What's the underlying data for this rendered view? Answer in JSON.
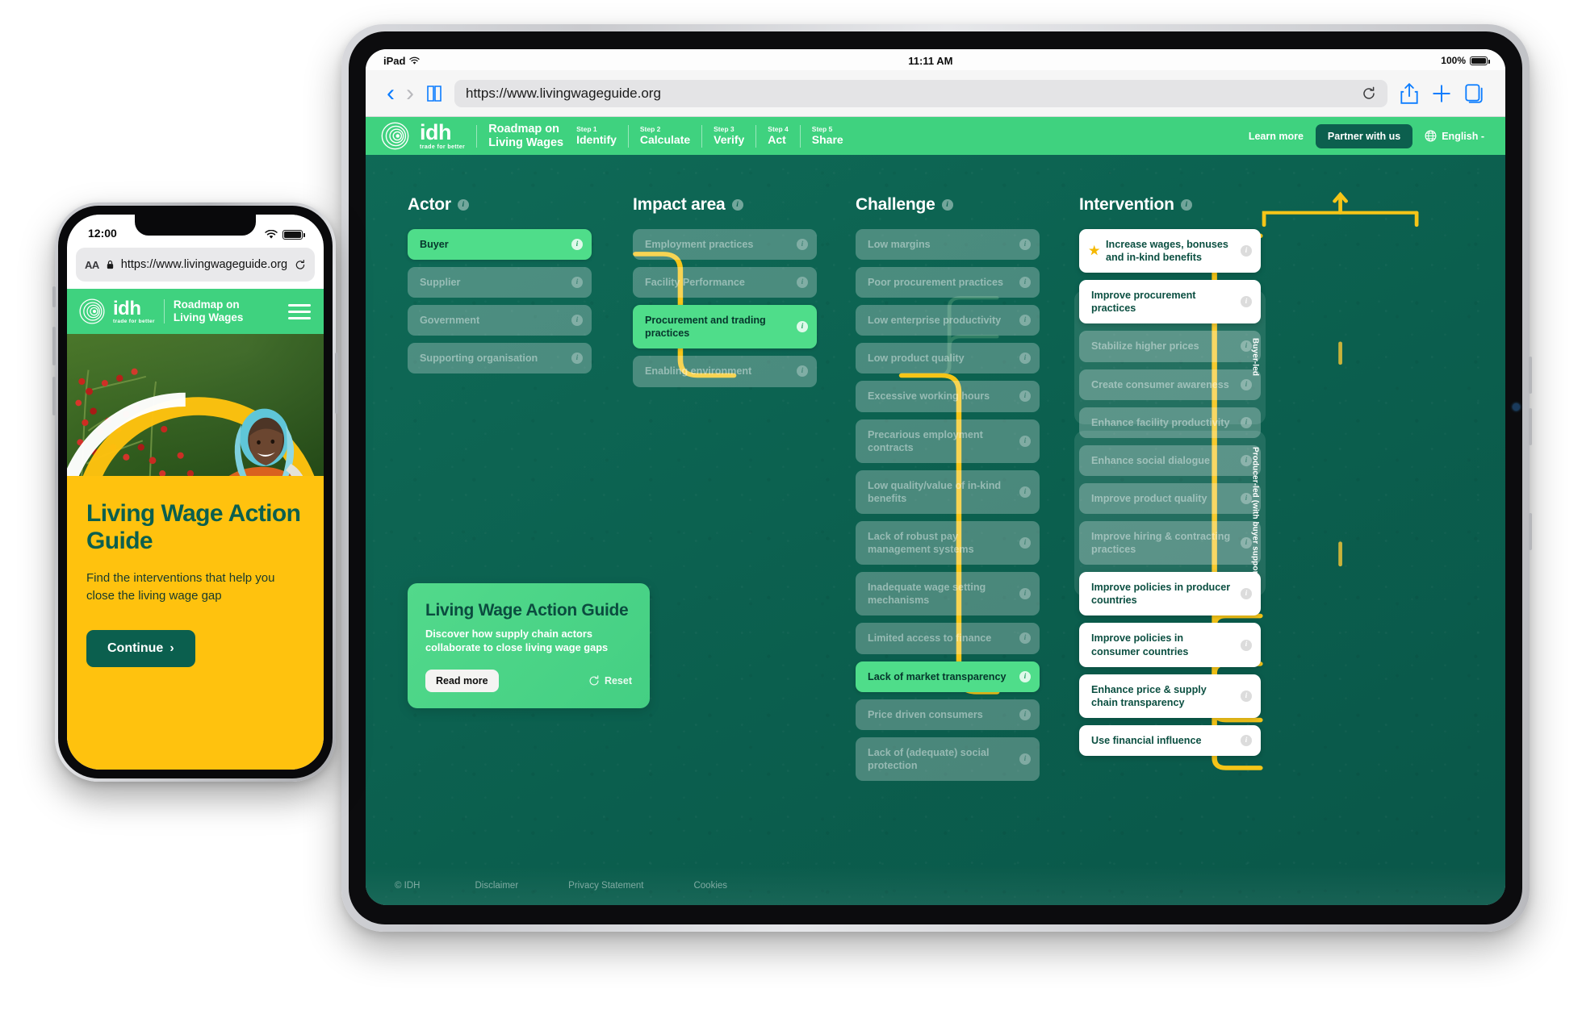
{
  "ipad": {
    "status": {
      "device": "iPad",
      "wifi_icon": "wifi-icon",
      "time": "11:11 AM",
      "battery": "100%"
    },
    "toolbar": {
      "back_icon": "chevron-left-icon",
      "forward_icon": "chevron-right-icon",
      "bookmarks_icon": "book-icon",
      "url": "https://www.livingwageguide.org",
      "reload_icon": "reload-icon",
      "share_icon": "share-icon",
      "new_tab_icon": "plus-icon",
      "tabs_icon": "tabs-icon"
    }
  },
  "site": {
    "nav": {
      "logo": "idh-logo",
      "brand_word": "idh",
      "brand_tagline": "trade for better",
      "title_line1": "Roadmap on",
      "title_line2": "Living Wages",
      "steps": [
        {
          "label": "Step 1",
          "name": "Identify"
        },
        {
          "label": "Step 2",
          "name": "Calculate"
        },
        {
          "label": "Step 3",
          "name": "Verify"
        },
        {
          "label": "Step 4",
          "name": "Act"
        },
        {
          "label": "Step 5",
          "name": "Share"
        }
      ],
      "learn_more": "Learn more",
      "partner": "Partner with us",
      "globe_icon": "globe-icon",
      "language": "English -"
    },
    "columns": [
      {
        "title": "Actor",
        "items": [
          {
            "label": "Buyer",
            "state": "active"
          },
          {
            "label": "Supplier",
            "state": "dim"
          },
          {
            "label": "Government",
            "state": "dim"
          },
          {
            "label": "Supporting organisation",
            "state": "dim"
          }
        ]
      },
      {
        "title": "Impact area",
        "items": [
          {
            "label": "Employment practices",
            "state": "dim"
          },
          {
            "label": "Facility Performance",
            "state": "dim"
          },
          {
            "label": "Procurement and trading practices",
            "state": "active"
          },
          {
            "label": "Enabling environment",
            "state": "dim"
          }
        ]
      },
      {
        "title": "Challenge",
        "items": [
          {
            "label": "Low margins",
            "state": "dim"
          },
          {
            "label": "Poor procurement practices",
            "state": "dim"
          },
          {
            "label": "Low enterprise productivity",
            "state": "dim"
          },
          {
            "label": "Low product quality",
            "state": "dim"
          },
          {
            "label": "Excessive working hours",
            "state": "dim"
          },
          {
            "label": "Precarious employment contracts",
            "state": "dim"
          },
          {
            "label": "Low quality/value of in-kind benefits",
            "state": "dim"
          },
          {
            "label": "Lack of robust pay management systems",
            "state": "dim"
          },
          {
            "label": "Inadequate wage setting mechanisms",
            "state": "dim"
          },
          {
            "label": "Limited access to finance",
            "state": "dim"
          },
          {
            "label": "Lack of market transparency",
            "state": "active"
          },
          {
            "label": "Price driven consumers",
            "state": "dim"
          },
          {
            "label": "Lack of (adequate) social protection",
            "state": "dim"
          }
        ]
      },
      {
        "title": "Intervention",
        "items": [
          {
            "label": "Increase wages, bonuses and in-kind benefits",
            "state": "white",
            "star": true
          },
          {
            "label": "Improve procurement practices",
            "state": "white"
          },
          {
            "label": "Stabilize higher prices",
            "state": "dim"
          },
          {
            "label": "Create consumer awareness",
            "state": "dim"
          },
          {
            "label": "Enhance facility productivity",
            "state": "dim"
          },
          {
            "label": "Enhance social dialogue",
            "state": "dim"
          },
          {
            "label": "Improve product quality",
            "state": "dim"
          },
          {
            "label": "Improve hiring & contracting practices",
            "state": "dim"
          },
          {
            "label": "Improve policies in producer countries",
            "state": "white"
          },
          {
            "label": "Improve policies in consumer countries",
            "state": "white"
          },
          {
            "label": "Enhance price & supply chain transparency",
            "state": "white"
          },
          {
            "label": "Use financial influence",
            "state": "white"
          }
        ],
        "groups": [
          {
            "label": "Buyer-led"
          },
          {
            "label": "Producer-led (with buyer support)"
          }
        ]
      }
    ],
    "promo": {
      "title": "Living Wage Action Guide",
      "subtitle": "Discover how supply chain actors collaborate to close living wage gaps",
      "read_more": "Read more",
      "reset": "Reset",
      "reset_icon": "reset-icon"
    },
    "footer": [
      "© IDH",
      "Disclaimer",
      "Privacy Statement",
      "Cookies"
    ],
    "colors": {
      "brand_green": "#3fd27f",
      "dark_teal": "#0b5f4e",
      "accent_yellow": "#ffc20e",
      "active_green": "#4fdd8a",
      "star_gold": "#f5b800"
    }
  },
  "phone": {
    "status": {
      "time": "12:00",
      "wifi_icon": "wifi-icon",
      "battery_icon": "battery-icon"
    },
    "url_bar": {
      "aa": "AA",
      "lock_icon": "lock-icon",
      "url": "https://www.livingwageguide.org",
      "reload_icon": "reload-icon"
    },
    "nav": {
      "logo": "idh-logo",
      "brand_word": "idh",
      "brand_tagline": "trade for better",
      "title_line1": "Roadmap on",
      "title_line2": "Living Wages",
      "menu_icon": "hamburger-icon"
    },
    "hero": {
      "image": "coffee-farmer-photo"
    },
    "body": {
      "title": "Living Wage Action Guide",
      "subtitle": "Find the interventions that help you close the living wage gap",
      "cta": "Continue",
      "cta_chevron": "›"
    }
  }
}
